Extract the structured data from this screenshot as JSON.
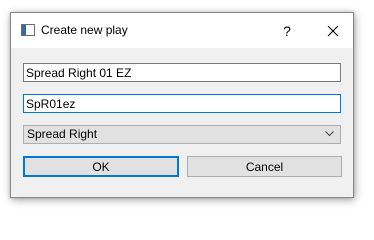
{
  "dialog": {
    "title": "Create new play",
    "help_label": "?",
    "icons": {
      "app": "window-icon",
      "close": "close-icon",
      "dropdown": "chevron-down-icon"
    }
  },
  "form": {
    "name_value": "Spread Right 01 EZ",
    "short_name_value": "SpR01ez",
    "formation_selected": "Spread Right"
  },
  "buttons": {
    "ok_label": "OK",
    "cancel_label": "Cancel"
  },
  "colors": {
    "accent": "#0078d7",
    "dialog_background": "#f0f0f0",
    "button_background": "#e1e1e1"
  }
}
